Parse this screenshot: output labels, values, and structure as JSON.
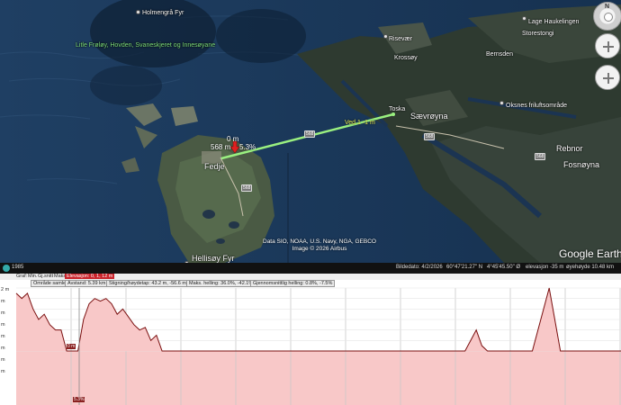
{
  "map": {
    "places": [
      {
        "name": "Holmengrå Fyr",
        "type": "white"
      },
      {
        "name": "Litle Frøløy, Hovden, Svaneskjeret og Innesøyane",
        "type": "green"
      },
      {
        "name": "Risevær",
        "type": "white"
      },
      {
        "name": "Krossøy",
        "type": "white"
      },
      {
        "name": "Toska",
        "type": "white"
      },
      {
        "name": "Sævrøyna",
        "type": "big"
      },
      {
        "name": "Storestongi",
        "type": "white"
      },
      {
        "name": "Lage Haukelingen",
        "type": "white"
      },
      {
        "name": "Bernsden",
        "type": "white"
      },
      {
        "name": "Oksnes friluftsområde",
        "type": "white"
      },
      {
        "name": "Rebnor",
        "type": "big"
      },
      {
        "name": "Fosnøyna",
        "type": "big"
      },
      {
        "name": "Fedje",
        "type": "big"
      },
      {
        "name": "Hellisøy Fyr",
        "type": "big"
      }
    ],
    "roads": [
      "568",
      "568",
      "568",
      "568"
    ],
    "path": {
      "height_label": "0 m",
      "distance_label": "568 m",
      "slope_label": "5.3%",
      "mid_label": "Ved 1 -1 m"
    },
    "attribution_lines": [
      "Data SIO, NOAA, U.S. Navy, NGA, GEBCO",
      "Image © 2026 Airbus"
    ],
    "brand": "Google Earth",
    "compass_letter": "N"
  },
  "statusbar": {
    "year": "1985",
    "image_date": "Bildedato: 4/2/2026",
    "lat": "60°47'21.27\" N",
    "lon": "4°45'45.50\" Ø",
    "elevation": "elevasjon  -35 m",
    "eye_alt": "øyehøyde   10.48 km"
  },
  "profile": {
    "header_items": [
      "Graf:",
      "Min.",
      "Gj.snitt",
      "Maks",
      "Elevasjon: 0, 1, 12 m"
    ],
    "stats": [
      "Område samlet",
      "Avstand: 5.39 km",
      "Stigning/høydetap: 43.2 m, -56.6 m",
      "Maks. helling: 36.0%, -42.1%",
      "Gjennomsnittlig helling: 0.8%, -7.5%"
    ],
    "y_ticks": [
      "2 m",
      "m",
      "m",
      "m",
      "m",
      "m",
      "m",
      "m"
    ],
    "cursor_value": "0 m",
    "cursor_pct": "5.3%",
    "colors": {
      "fill": "#f8c8c8",
      "line": "#7a0f0f",
      "grid": "#c8c8c8",
      "header_accent": "#c9232b"
    }
  },
  "chart_data": {
    "type": "area",
    "title": "",
    "xlabel": "",
    "ylabel": "Elevasjon",
    "x_unit": "km",
    "ylim": [
      0,
      12
    ],
    "x": [
      0.0,
      0.05,
      0.1,
      0.15,
      0.2,
      0.25,
      0.3,
      0.35,
      0.4,
      0.45,
      0.5,
      0.55,
      0.6,
      0.65,
      0.7,
      0.75,
      0.8,
      0.85,
      0.9,
      0.95,
      1.0,
      1.05,
      1.1,
      1.15,
      1.2,
      1.25,
      1.3,
      1.35,
      1.4,
      1.45,
      4.0,
      4.05,
      4.1,
      4.15,
      4.2,
      4.6,
      4.65,
      4.7,
      4.75,
      4.8,
      4.85,
      4.9,
      5.39
    ],
    "values": [
      11,
      10,
      11,
      8,
      6,
      7,
      5,
      4,
      4,
      0,
      0,
      0,
      6,
      9,
      10,
      9.5,
      10,
      9,
      7,
      8,
      6.5,
      5,
      4,
      4.5,
      2,
      3,
      0,
      0,
      0,
      0,
      0,
      2,
      4,
      1,
      0,
      0,
      4,
      8,
      12,
      6,
      0,
      0,
      0
    ]
  }
}
